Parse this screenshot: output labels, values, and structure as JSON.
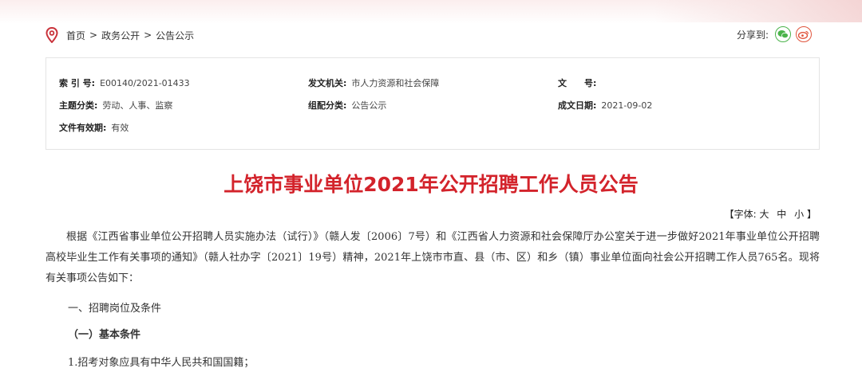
{
  "breadcrumb": {
    "items": [
      "首页",
      "政务公开",
      "公告公示"
    ],
    "separator": ">"
  },
  "share": {
    "label": "分享到:",
    "wechat_icon": "wechat-icon",
    "weibo_icon": "weibo-icon"
  },
  "meta": {
    "index_no": {
      "label": "索 引 号:",
      "value": "E00140/2021-01433"
    },
    "issuer": {
      "label": "发文机关:",
      "value": "市人力资源和社会保障"
    },
    "doc_no": {
      "label": "文　　号:",
      "value": ""
    },
    "subject": {
      "label": "主题分类:",
      "value": "劳动、人事、监察"
    },
    "group": {
      "label": "组配分类:",
      "value": "公告公示"
    },
    "date": {
      "label": "成文日期:",
      "value": "2021-09-02"
    },
    "validity": {
      "label": "文件有效期:",
      "value": "有效"
    }
  },
  "article": {
    "title": "上饶市事业单位2021年公开招聘工作人员公告",
    "font_size": {
      "prefix": "【字体:",
      "large": "大",
      "medium": "中",
      "small": "小",
      "suffix": "】"
    },
    "paragraph1": "根据《江西省事业单位公开招聘人员实施办法（试行）》（赣人发〔2006〕7号）和《江西省人力资源和社会保障厅办公室关于进一步做好2021年事业单位公开招聘高校毕业生工作有关事项的通知》（赣人社办字〔2021〕19号）精神，2021年上饶市市直、县（市、区）和乡（镇）事业单位面向社会公开招聘工作人员765名。现将有关事项公告如下：",
    "section1": "一、招聘岗位及条件",
    "subsection1": "（一）基本条件",
    "item1": "1.招考对象应具有中华人民共和国国籍；"
  },
  "colors": {
    "title": "#d3232b",
    "wechat": "#4bb34b",
    "weibo": "#e0533b",
    "pin": "#c9323a"
  }
}
